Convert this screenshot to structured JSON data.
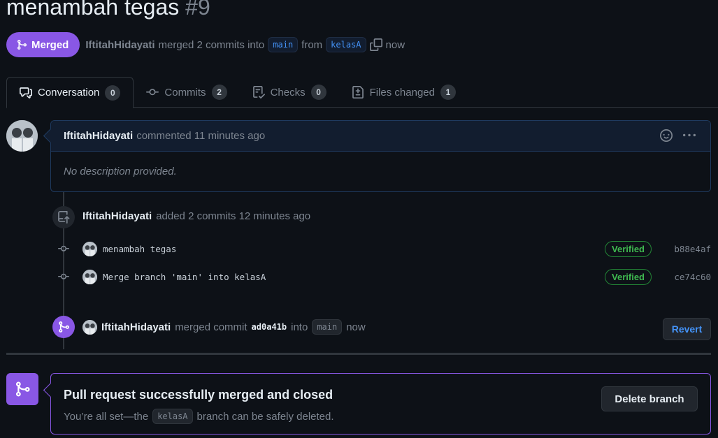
{
  "pr": {
    "title": "menambah tegas",
    "number": "#9",
    "status_label": "Merged",
    "author": "IftitahHidayati",
    "merge_text": "merged 2 commits into",
    "base_branch": "main",
    "from_text": "from",
    "head_branch": "kelasA",
    "time": "now"
  },
  "tabs": [
    {
      "label": "Conversation",
      "count": "0",
      "icon": "comment-discussion-icon"
    },
    {
      "label": "Commits",
      "count": "2",
      "icon": "git-commit-icon"
    },
    {
      "label": "Checks",
      "count": "0",
      "icon": "checklist-icon"
    },
    {
      "label": "Files changed",
      "count": "1",
      "icon": "file-diff-icon"
    }
  ],
  "comment": {
    "author": "IftitahHidayati",
    "meta": "commented 11 minutes ago",
    "body": "No description provided."
  },
  "commits_event": {
    "author": "IftitahHidayati",
    "text": "added 2 commits 12 minutes ago"
  },
  "commits": [
    {
      "message": "menambah tegas",
      "verified": "Verified",
      "sha": "b88e4af"
    },
    {
      "message": "Merge branch 'main' into kelasA",
      "verified": "Verified",
      "sha": "ce74c60"
    }
  ],
  "merge_event": {
    "author": "IftitahHidayati",
    "text1": "merged commit",
    "sha": "ad0a41b",
    "text2": "into",
    "branch": "main",
    "time": "now",
    "revert_label": "Revert"
  },
  "merge_box": {
    "title": "Pull request successfully merged and closed",
    "sub_before": "You’re all set—the",
    "branch": "kelasA",
    "sub_after": "branch can be safely deleted.",
    "delete_label": "Delete branch"
  },
  "colors": {
    "merged_purple": "#8957e5",
    "link_blue": "#4493f8",
    "verified_green": "#3fb950",
    "background": "#0d1117"
  }
}
